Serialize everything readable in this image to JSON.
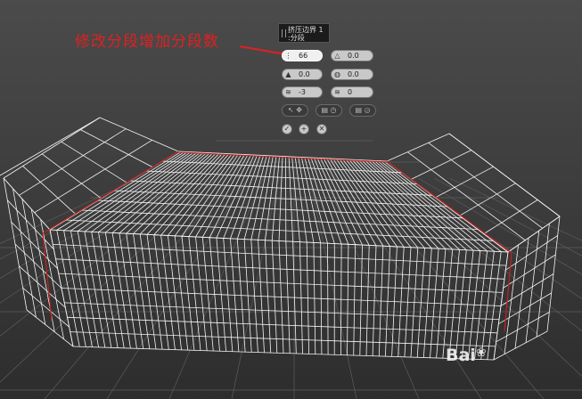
{
  "annotation": {
    "text": "修改分段增加分段数",
    "color": "#e02020"
  },
  "caddy": {
    "title_line1": "挤压边界 1",
    "title_line2": ":分段",
    "segments": {
      "icon": "segments-icon",
      "value": "66"
    },
    "ratio": {
      "icon": "ratio-icon",
      "value": "0.0"
    },
    "depth": {
      "icon": "depth-icon",
      "value": "0.0"
    },
    "radius": {
      "icon": "radius-icon",
      "value": "0.0"
    },
    "twist": {
      "icon": "twist-icon",
      "value": "-3"
    },
    "offset": {
      "icon": "offset-icon",
      "value": "0"
    },
    "ok_icon": "checkmark-icon",
    "apply_icon": "plus-icon",
    "cancel_icon": "close-icon"
  },
  "watermark": {
    "text": "Bai"
  },
  "colors": {
    "wire": "#f4f4f4",
    "edge_highlight": "#c62020",
    "bg_top": "#4c4c4c",
    "bg_bottom": "#2e2e2e"
  }
}
